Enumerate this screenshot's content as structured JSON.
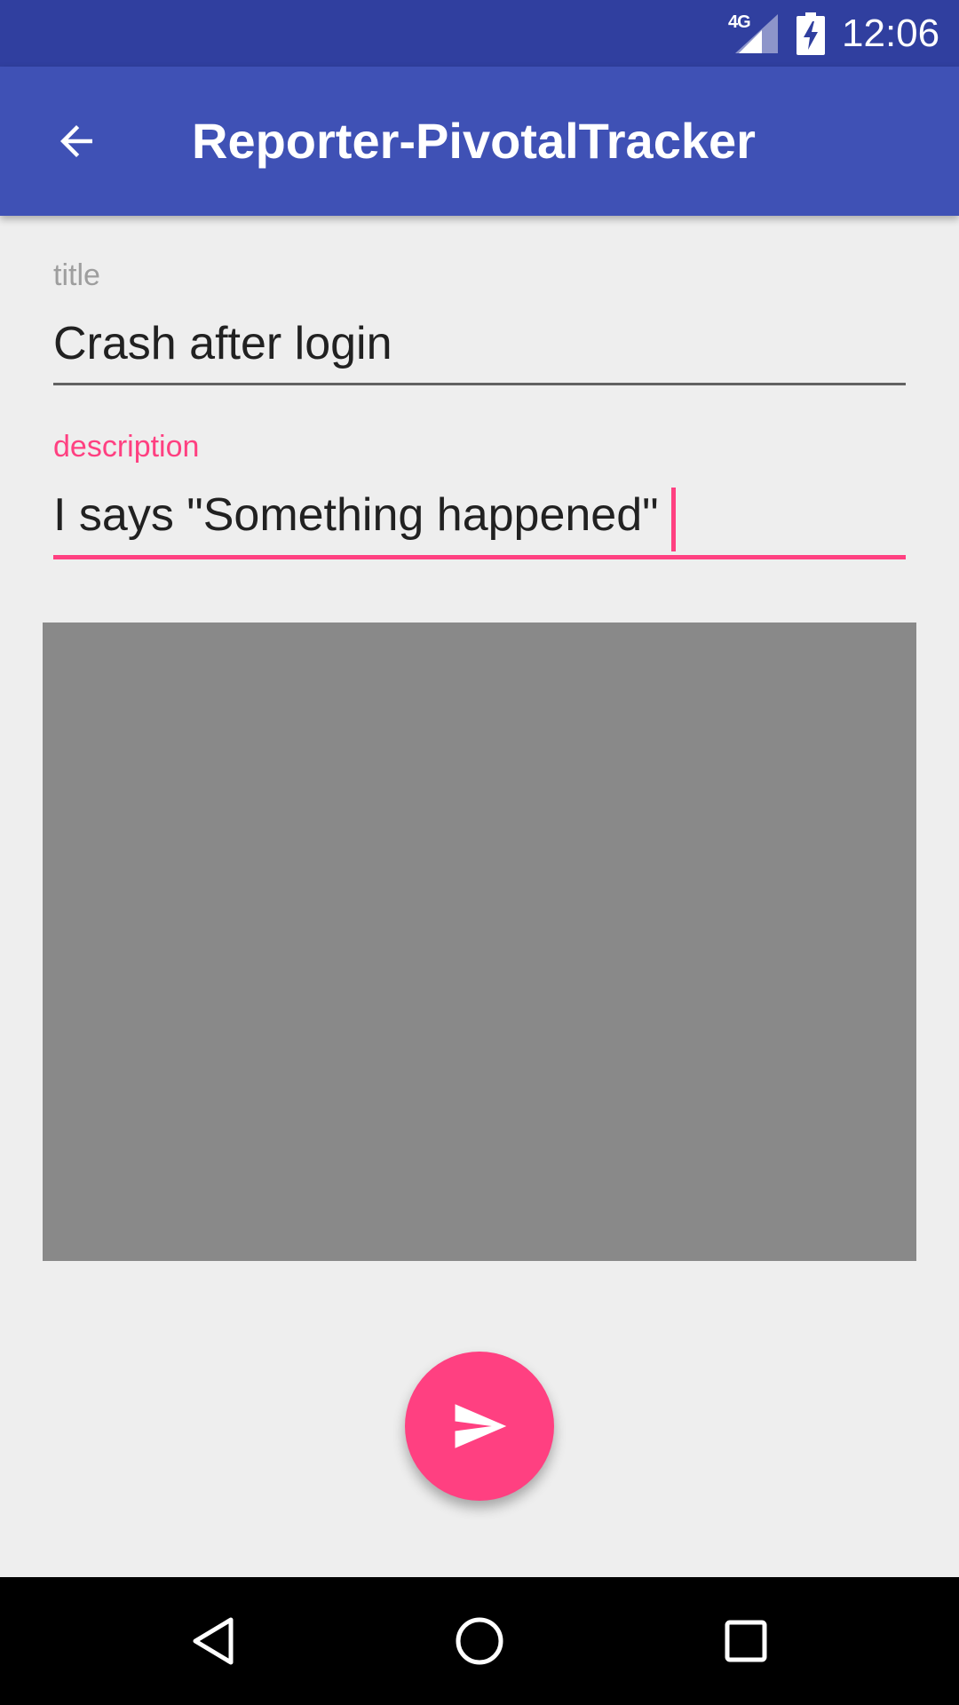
{
  "status_bar": {
    "network_type": "4G",
    "time": "12:06",
    "icons": [
      "signal-icon",
      "battery-charging-icon"
    ],
    "color": "#303F9F"
  },
  "app_bar": {
    "title": "Reporter-PivotalTracker",
    "back_icon": "arrow-back-icon",
    "color": "#3F51B5"
  },
  "form": {
    "title_label": "title",
    "title_value": "Crash after login",
    "description_label": "description",
    "description_value": "I says \"Something happened\""
  },
  "fab": {
    "icon": "send-icon",
    "color": "#FF4081"
  },
  "nav_bar": {
    "icons": [
      "nav-back-icon",
      "nav-home-icon",
      "nav-recents-icon"
    ]
  },
  "colors": {
    "accent": "#FF4081",
    "primary": "#3F51B5",
    "primary_dark": "#303F9F",
    "background": "#EEEEEE",
    "preview": "#898989"
  }
}
